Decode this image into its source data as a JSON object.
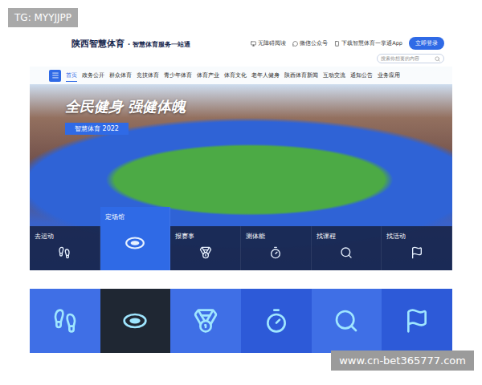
{
  "watermarks": {
    "top": "TG: MYYJJPP",
    "bottom": "www.cn-bet365777.com"
  },
  "header": {
    "logo": "陕西智慧体育",
    "slogan": "· 智慧体育服务一站通",
    "links": [
      "无障碍阅读",
      "微信公众号",
      "下载智慧体育一掌通App"
    ],
    "login": "立即登录",
    "search": {
      "placeholder": "搜索你想要的内容"
    }
  },
  "nav": [
    {
      "label": "首页",
      "selected": true
    },
    {
      "label": "政务公开",
      "selected": false
    },
    {
      "label": "群众体育",
      "selected": false
    },
    {
      "label": "竞技体育",
      "selected": false
    },
    {
      "label": "青少年体育",
      "selected": false
    },
    {
      "label": "体育产业",
      "selected": false
    },
    {
      "label": "体育文化",
      "selected": false
    },
    {
      "label": "老年人健身",
      "selected": false
    },
    {
      "label": "陕西体育新闻",
      "selected": false
    },
    {
      "label": "互动交流",
      "selected": false
    },
    {
      "label": "通知公告",
      "selected": false
    },
    {
      "label": "业务应用",
      "selected": false
    }
  ],
  "hero": {
    "title": "全民健身 强健体魄",
    "badge": "智慧体育 2022"
  },
  "tiles": [
    {
      "label": "去运动",
      "selected": false
    },
    {
      "label": "定场馆",
      "selected": true
    },
    {
      "label": "报赛事",
      "selected": false
    },
    {
      "label": "测体能",
      "selected": false
    },
    {
      "label": "找课程",
      "selected": false
    },
    {
      "label": "找活动",
      "selected": false
    }
  ],
  "strip": [
    {
      "selected": false
    },
    {
      "selected": true
    },
    {
      "selected": false
    },
    {
      "selected": false
    },
    {
      "selected": false
    },
    {
      "selected": false
    }
  ]
}
